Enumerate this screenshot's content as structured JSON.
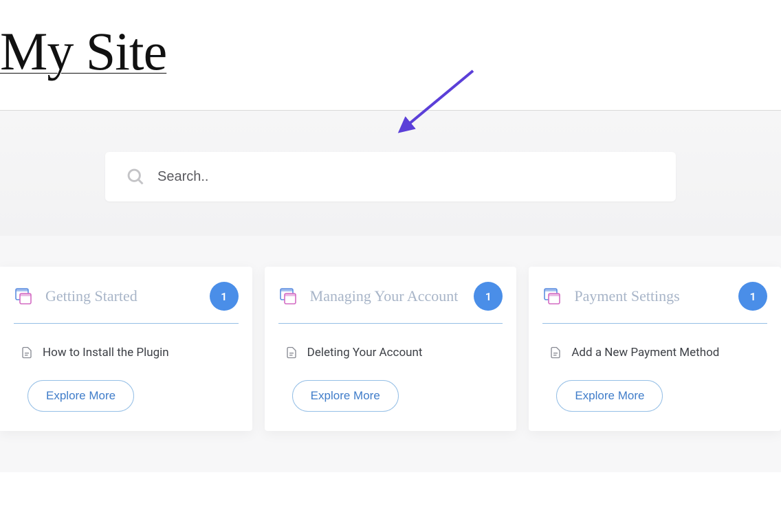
{
  "site_title": "My Site",
  "search": {
    "placeholder": "Search.."
  },
  "cards": [
    {
      "title": "Getting Started",
      "count": "1",
      "article": "How to Install the Plugin",
      "button": "Explore More"
    },
    {
      "title": "Managing Your Account",
      "count": "1",
      "article": "Deleting Your Account",
      "button": "Explore More"
    },
    {
      "title": "Payment Settings",
      "count": "1",
      "article": "Add a New Payment Method",
      "button": "Explore More"
    }
  ],
  "colors": {
    "accent": "#4a8ee8",
    "title_muted": "#a8b5c8",
    "arrow": "#5b3fd8"
  }
}
